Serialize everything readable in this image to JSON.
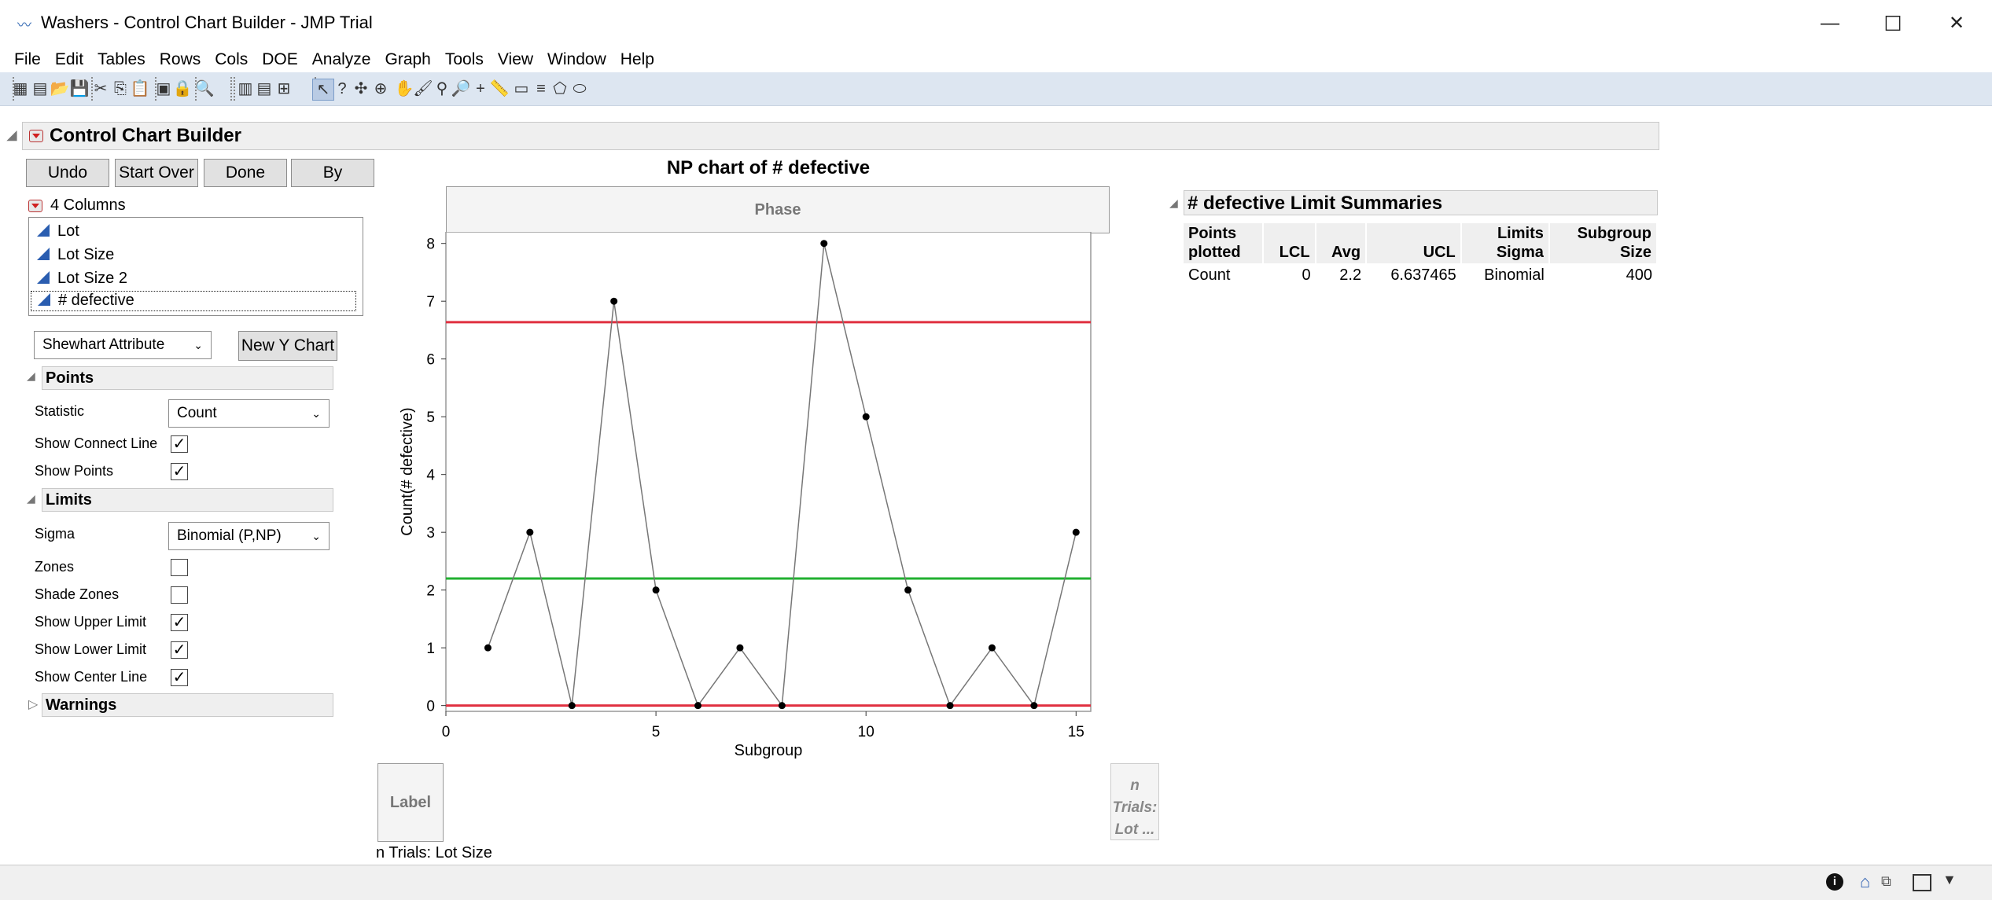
{
  "window": {
    "title": "Washers - Control Chart Builder - JMP Trial",
    "minimize": "—",
    "maximize": "☐",
    "close": "✕"
  },
  "menu": [
    "File",
    "Edit",
    "Tables",
    "Rows",
    "Cols",
    "DOE",
    "Analyze",
    "Graph",
    "Tools",
    "View",
    "Window",
    "Help"
  ],
  "toolbar_icons": [
    "new-data-table-icon",
    "new-script-icon",
    "open-icon",
    "save-icon",
    "cut-icon",
    "copy-icon",
    "paste-icon",
    "journal-icon",
    "lock-icon",
    "search-icon",
    "data-table-list-icon",
    "column-info-icon",
    "add-data-icon",
    "arrow-icon",
    "help-icon",
    "crosshair-icon",
    "lasso-icon",
    "hand-icon",
    "brush-icon",
    "magnifier-icon",
    "zoom-icon",
    "plus-icon",
    "ruler-icon",
    "text-box-icon",
    "line-icon",
    "polygon-icon",
    "ellipse-icon"
  ],
  "panel": {
    "title": "Control Chart Builder",
    "buttons": {
      "undo": "Undo",
      "start_over": "Start Over",
      "done": "Done",
      "by": "By"
    },
    "columns_header": "4 Columns",
    "columns": [
      "Lot",
      "Lot Size",
      "Lot Size 2",
      "# defective"
    ],
    "chart_type": "Shewhart Attribute",
    "new_y_chart": "New Y Chart",
    "points": {
      "title": "Points",
      "statistic_label": "Statistic",
      "statistic_value": "Count",
      "show_connect_line": "Show Connect Line",
      "show_points": "Show Points"
    },
    "limits": {
      "title": "Limits",
      "sigma_label": "Sigma",
      "sigma_value": "Binomial (P,NP)",
      "zones": "Zones",
      "shade_zones": "Shade Zones",
      "show_upper": "Show Upper Limit",
      "show_lower": "Show Lower Limit",
      "show_center": "Show Center Line"
    },
    "warnings": "Warnings",
    "checks": {
      "connect": true,
      "points": true,
      "zones": false,
      "shade": false,
      "upper": true,
      "lower": true,
      "center": true
    }
  },
  "chart_zone": {
    "phase": "Phase",
    "label": "Label",
    "n_trials_zone": "n Trials: Lot ...",
    "n_trials_footer": "n Trials: Lot Size"
  },
  "chart_data": {
    "type": "line",
    "title": "NP chart of # defective",
    "xlabel": "Subgroup",
    "ylabel": "Count(# defective)",
    "x": [
      1,
      2,
      3,
      4,
      5,
      6,
      7,
      8,
      9,
      10,
      11,
      12,
      13,
      14,
      15
    ],
    "y": [
      1,
      3,
      0,
      7,
      2,
      0,
      1,
      0,
      8,
      5,
      2,
      0,
      1,
      0,
      3
    ],
    "xlim": [
      0,
      15.35
    ],
    "ylim": [
      -0.1,
      8.2
    ],
    "xticks": [
      0,
      5,
      10,
      15
    ],
    "yticks": [
      0,
      1,
      2,
      3,
      4,
      5,
      6,
      7,
      8
    ],
    "ucl": 6.637465,
    "lcl": 0,
    "center": 2.2,
    "colors": {
      "limits": "#e03040",
      "center": "#22b030",
      "line": "#777777",
      "points": "#000000"
    }
  },
  "summary": {
    "title": "# defective Limit Summaries",
    "headers": [
      [
        "Points",
        "plotted"
      ],
      [
        "",
        "LCL"
      ],
      [
        "",
        "Avg"
      ],
      [
        "",
        "UCL"
      ],
      [
        "Limits",
        "Sigma"
      ],
      [
        "Subgroup",
        "Size"
      ]
    ],
    "rows": [
      [
        "Count",
        "0",
        "2.2",
        "6.637465",
        "Binomial",
        "400"
      ]
    ]
  }
}
